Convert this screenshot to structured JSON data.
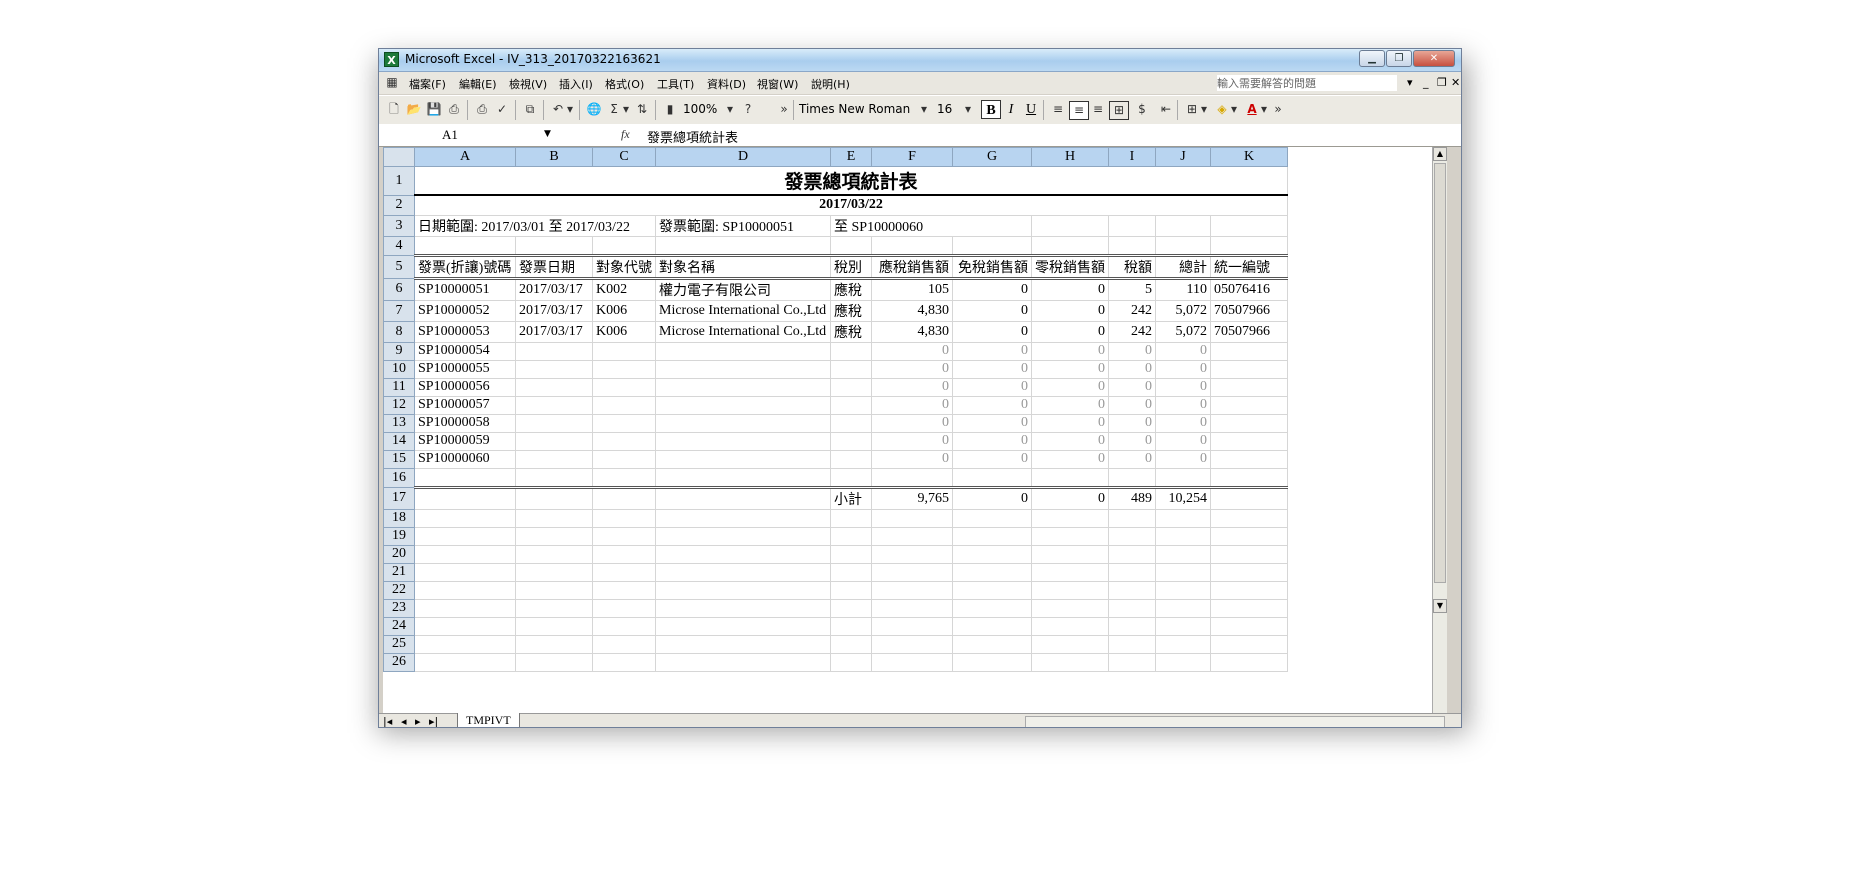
{
  "window": {
    "title": "Microsoft Excel - IV_313_20170322163621",
    "app_icon": "X"
  },
  "menu": {
    "items": [
      "檔案(F)",
      "編輯(E)",
      "檢視(V)",
      "插入(I)",
      "格式(O)",
      "工具(T)",
      "資料(D)",
      "視窗(W)",
      "說明(H)"
    ],
    "help_placeholder": "輸入需要解答的問題"
  },
  "toolbar": {
    "zoom": "100%",
    "font_name": "Times New Roman",
    "font_size": "16",
    "bold": "B",
    "italic": "I",
    "underline": "U"
  },
  "formula_bar": {
    "name_box": "A1",
    "fx": "fx",
    "content": "發票總項統計表"
  },
  "sheet": {
    "columns": [
      "A",
      "B",
      "C",
      "D",
      "E",
      "F",
      "G",
      "H",
      "I",
      "J",
      "K"
    ],
    "title": "發票總項統計表",
    "date": "2017/03/22",
    "range_line": "日期範圍: 2017/03/01 至 2017/03/22",
    "invoice_range": "發票範圍: SP10000051",
    "invoice_to": "至 SP10000060",
    "headers": [
      "發票(折讓)號碼",
      "發票日期",
      "對象代號",
      "對象名稱",
      "稅別",
      "應稅銷售額",
      "免稅銷售額",
      "零稅銷售額",
      "稅額",
      "總計",
      "統一編號"
    ],
    "rows": [
      [
        "SP10000051",
        "2017/03/17",
        "K002",
        "權力電子有限公司",
        "應稅",
        "105",
        "0",
        "0",
        "5",
        "110",
        "05076416"
      ],
      [
        "SP10000052",
        "2017/03/17",
        "K006",
        "Microse International Co.,Ltd",
        "應稅",
        "4,830",
        "0",
        "0",
        "242",
        "5,072",
        "70507966"
      ],
      [
        "SP10000053",
        "2017/03/17",
        "K006",
        "Microse International Co.,Ltd",
        "應稅",
        "4,830",
        "0",
        "0",
        "242",
        "5,072",
        "70507966"
      ],
      [
        "SP10000054",
        "",
        "",
        "",
        "",
        "0",
        "0",
        "0",
        "0",
        "0",
        ""
      ],
      [
        "SP10000055",
        "",
        "",
        "",
        "",
        "0",
        "0",
        "0",
        "0",
        "0",
        ""
      ],
      [
        "SP10000056",
        "",
        "",
        "",
        "",
        "0",
        "0",
        "0",
        "0",
        "0",
        ""
      ],
      [
        "SP10000057",
        "",
        "",
        "",
        "",
        "0",
        "0",
        "0",
        "0",
        "0",
        ""
      ],
      [
        "SP10000058",
        "",
        "",
        "",
        "",
        "0",
        "0",
        "0",
        "0",
        "0",
        ""
      ],
      [
        "SP10000059",
        "",
        "",
        "",
        "",
        "0",
        "0",
        "0",
        "0",
        "0",
        ""
      ],
      [
        "SP10000060",
        "",
        "",
        "",
        "",
        "0",
        "0",
        "0",
        "0",
        "0",
        ""
      ]
    ],
    "subtotal": [
      "",
      "",
      "",
      "",
      "小計",
      "9,765",
      "0",
      "0",
      "489",
      "10,254",
      ""
    ],
    "row_numbers": [
      "1",
      "2",
      "3",
      "4",
      "5",
      "6",
      "7",
      "8",
      "9",
      "10",
      "11",
      "12",
      "13",
      "14",
      "15",
      "16",
      "17",
      "18",
      "19",
      "20",
      "21",
      "22",
      "23",
      "24",
      "25",
      "26"
    ]
  },
  "sheet_tab": "TMPIVT"
}
